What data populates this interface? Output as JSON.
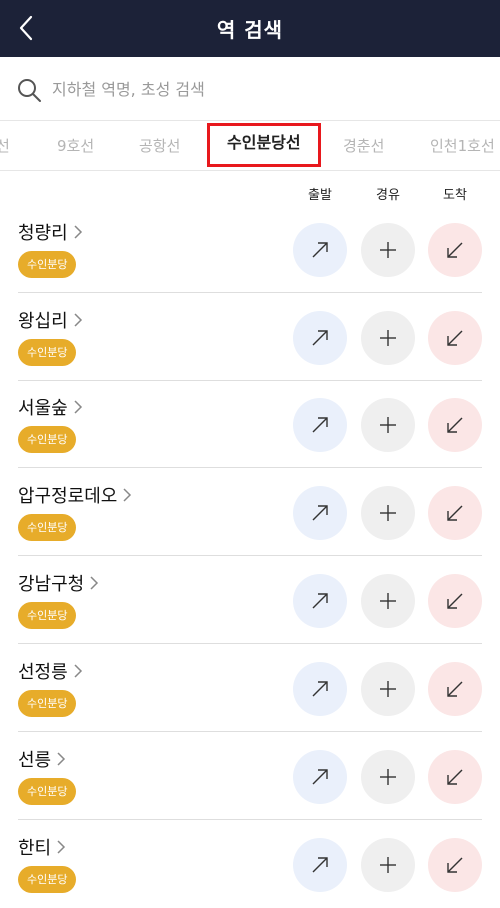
{
  "header": {
    "title": "역 검색",
    "back_icon": "chevron-left-icon"
  },
  "search": {
    "placeholder": "지하철 역명, 초성 검색",
    "value": "",
    "icon": "search-icon"
  },
  "tabs": [
    {
      "label": "선",
      "active": false
    },
    {
      "label": "9호선",
      "active": false
    },
    {
      "label": "공항선",
      "active": false
    },
    {
      "label": "수인분당선",
      "active": true
    },
    {
      "label": "경춘선",
      "active": false
    },
    {
      "label": "인천1호선",
      "active": false
    }
  ],
  "columns": {
    "departure": "출발",
    "via": "경유",
    "arrival": "도착"
  },
  "colors": {
    "header_bg": "#1c2238",
    "line_badge": "#e7ac2a",
    "active_tab_border": "#e8181d",
    "dep_bg": "#eaf0fb",
    "via_bg": "#efefef",
    "arr_bg": "#fbe6e6"
  },
  "stations": [
    {
      "name": "청량리",
      "line": "수인분당"
    },
    {
      "name": "왕십리",
      "line": "수인분당"
    },
    {
      "name": "서울숲",
      "line": "수인분당"
    },
    {
      "name": "압구정로데오",
      "line": "수인분당"
    },
    {
      "name": "강남구청",
      "line": "수인분당"
    },
    {
      "name": "선정릉",
      "line": "수인분당"
    },
    {
      "name": "선릉",
      "line": "수인분당"
    },
    {
      "name": "한티",
      "line": "수인분당"
    }
  ]
}
